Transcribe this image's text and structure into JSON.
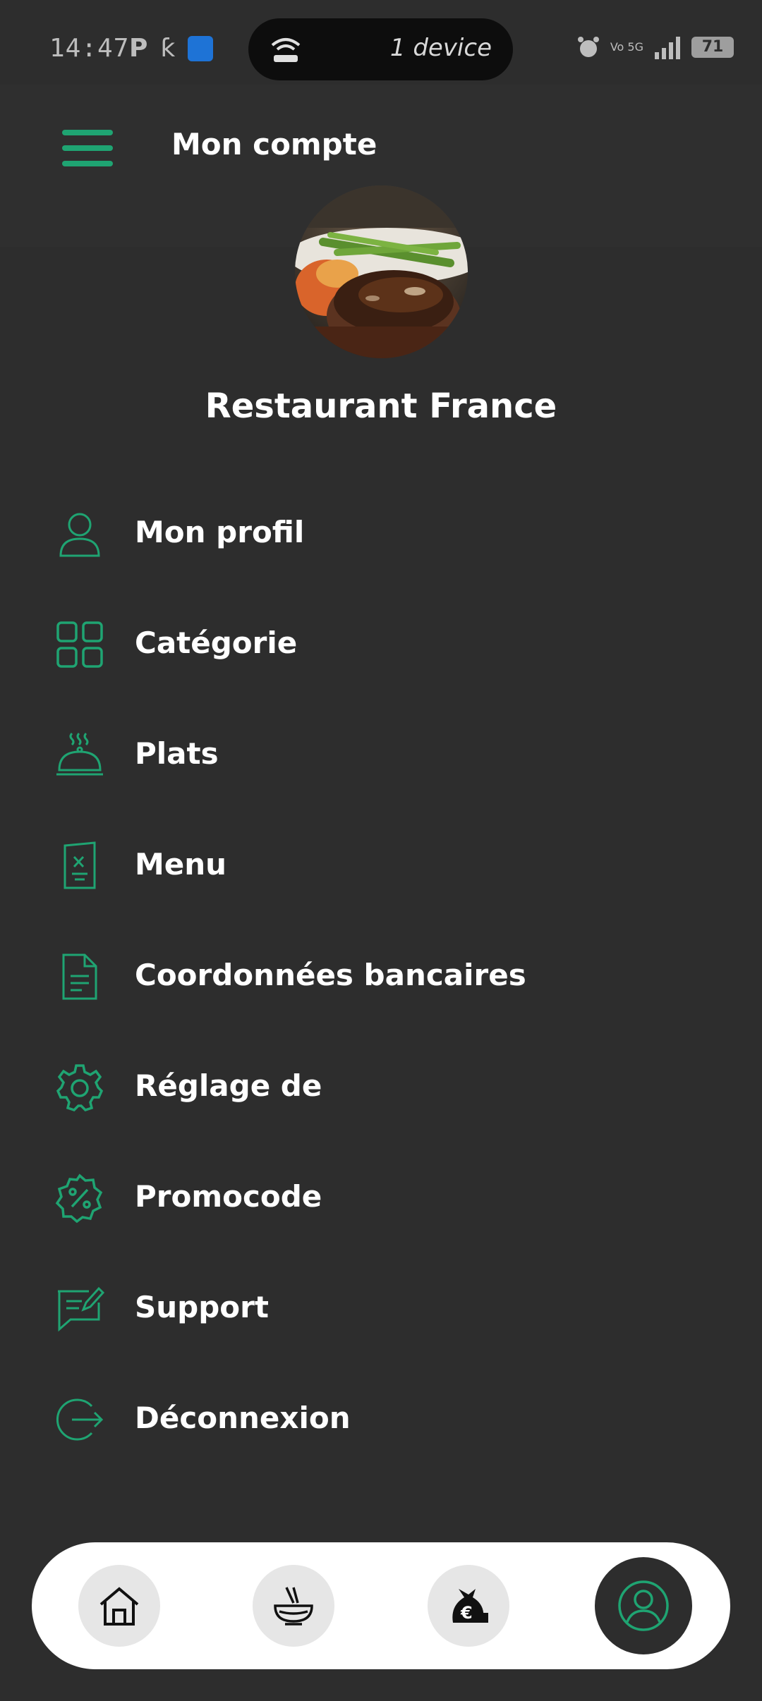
{
  "status_bar": {
    "time": "14:47",
    "pill_text": "1 device",
    "battery": "71",
    "volte": "Vo 5G",
    "network": "5G"
  },
  "header": {
    "title": "Mon compte"
  },
  "profile": {
    "name": "Restaurant France"
  },
  "menu": {
    "items": [
      {
        "label": "Mon profil",
        "icon": "user-icon"
      },
      {
        "label": "Catégorie",
        "icon": "grid-icon"
      },
      {
        "label": "Plats",
        "icon": "cloche-icon"
      },
      {
        "label": "Menu",
        "icon": "menu-card-icon"
      },
      {
        "label": "Coordonnées bancaires",
        "icon": "document-icon"
      },
      {
        "label": "Réglage de",
        "icon": "gear-icon"
      },
      {
        "label": "Promocode",
        "icon": "promo-badge-icon"
      },
      {
        "label": "Support",
        "icon": "message-edit-icon"
      },
      {
        "label": "Déconnexion",
        "icon": "logout-icon"
      }
    ]
  },
  "bottom_nav": {
    "items": [
      "home-icon",
      "noodle-bowl-icon",
      "money-bag-euro-icon",
      "account-icon"
    ],
    "active": "account-icon"
  },
  "colors": {
    "background": "#2d2d2d",
    "accent": "#1fa472",
    "text": "#ffffff",
    "nav_bg": "#ffffff"
  }
}
